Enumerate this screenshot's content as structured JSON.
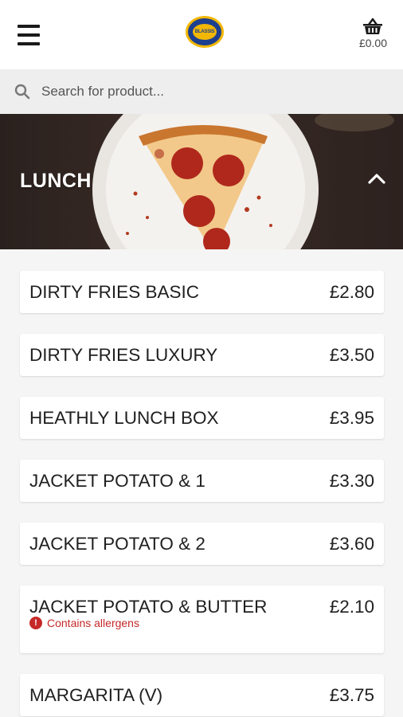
{
  "header": {
    "menu_icon": "hamburger-menu-icon",
    "logo_text": "BLASSIS",
    "cart_icon": "basket-icon",
    "cart_total": "£0.00"
  },
  "search": {
    "placeholder": "Search for product...",
    "value": ""
  },
  "category": {
    "title": "LUNCH",
    "expanded": true,
    "chevron_icon": "chevron-up-icon"
  },
  "products": [
    {
      "name": "DIRTY FRIES BASIC",
      "price": "£2.80"
    },
    {
      "name": "DIRTY FRIES LUXURY",
      "price": "£3.50"
    },
    {
      "name": "HEATHLY LUNCH BOX",
      "price": "£3.95"
    },
    {
      "name": "JACKET POTATO & 1",
      "price": "£3.30"
    },
    {
      "name": "JACKET POTATO & 2",
      "price": "£3.60"
    },
    {
      "name": "JACKET POTATO & BUTTER",
      "price": "£2.10",
      "allergen_note": "Contains allergens"
    },
    {
      "name": "MARGARITA (V)",
      "price": "£3.75"
    }
  ],
  "colors": {
    "allergen": "#c62828",
    "logo_blue": "#1d3f8f",
    "logo_yellow": "#f2b705"
  }
}
